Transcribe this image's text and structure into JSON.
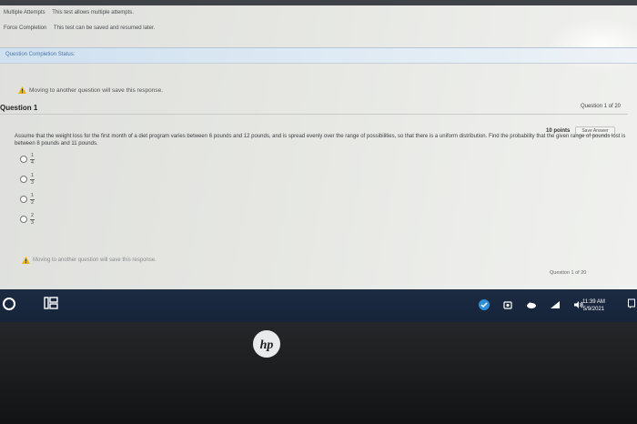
{
  "test_info": {
    "multiple_attempts_label": "Multiple Attempts",
    "multiple_attempts_value": "This test allows multiple attempts.",
    "force_completion_label": "Force Completion",
    "force_completion_value": "This test can be saved and resumed later."
  },
  "question_completion": {
    "label": "Question Completion Status:"
  },
  "warning_text": "Moving to another question will save this response.",
  "question": {
    "title": "Question 1",
    "counter": "Question 1 of 20",
    "points": "10 points",
    "save_answer": "Save Answer",
    "text": "Assume that the weight loss for the first month of a diet program varies between 6 pounds and 12 pounds, and is spread evenly over the range of possibilities, so that there is a uniform distribution. Find the probability that the given range of pounds lost is between 8 pounds and 11 pounds.",
    "options": [
      {
        "numerator": "1",
        "denominator": "4"
      },
      {
        "numerator": "1",
        "denominator": "3"
      },
      {
        "numerator": "1",
        "denominator": "2"
      },
      {
        "numerator": "2",
        "denominator": "3"
      }
    ]
  },
  "bottom_warning_text": "Moving to another question will save this response.",
  "bottom_counter": "Question 1 of 20",
  "taskbar": {
    "time": "11:39 AM",
    "date": "5/9/2021",
    "icons": [
      "cortana-icon",
      "task-view-icon",
      "security-icon",
      "onedrive-icon",
      "cloud-icon",
      "wifi-icon",
      "volume-icon"
    ]
  },
  "brand": {
    "logo": "hp"
  },
  "colors": {
    "taskbar": "#1c2b42",
    "link_blue": "#4a78a8",
    "warning_yellow": "#e8b400"
  }
}
